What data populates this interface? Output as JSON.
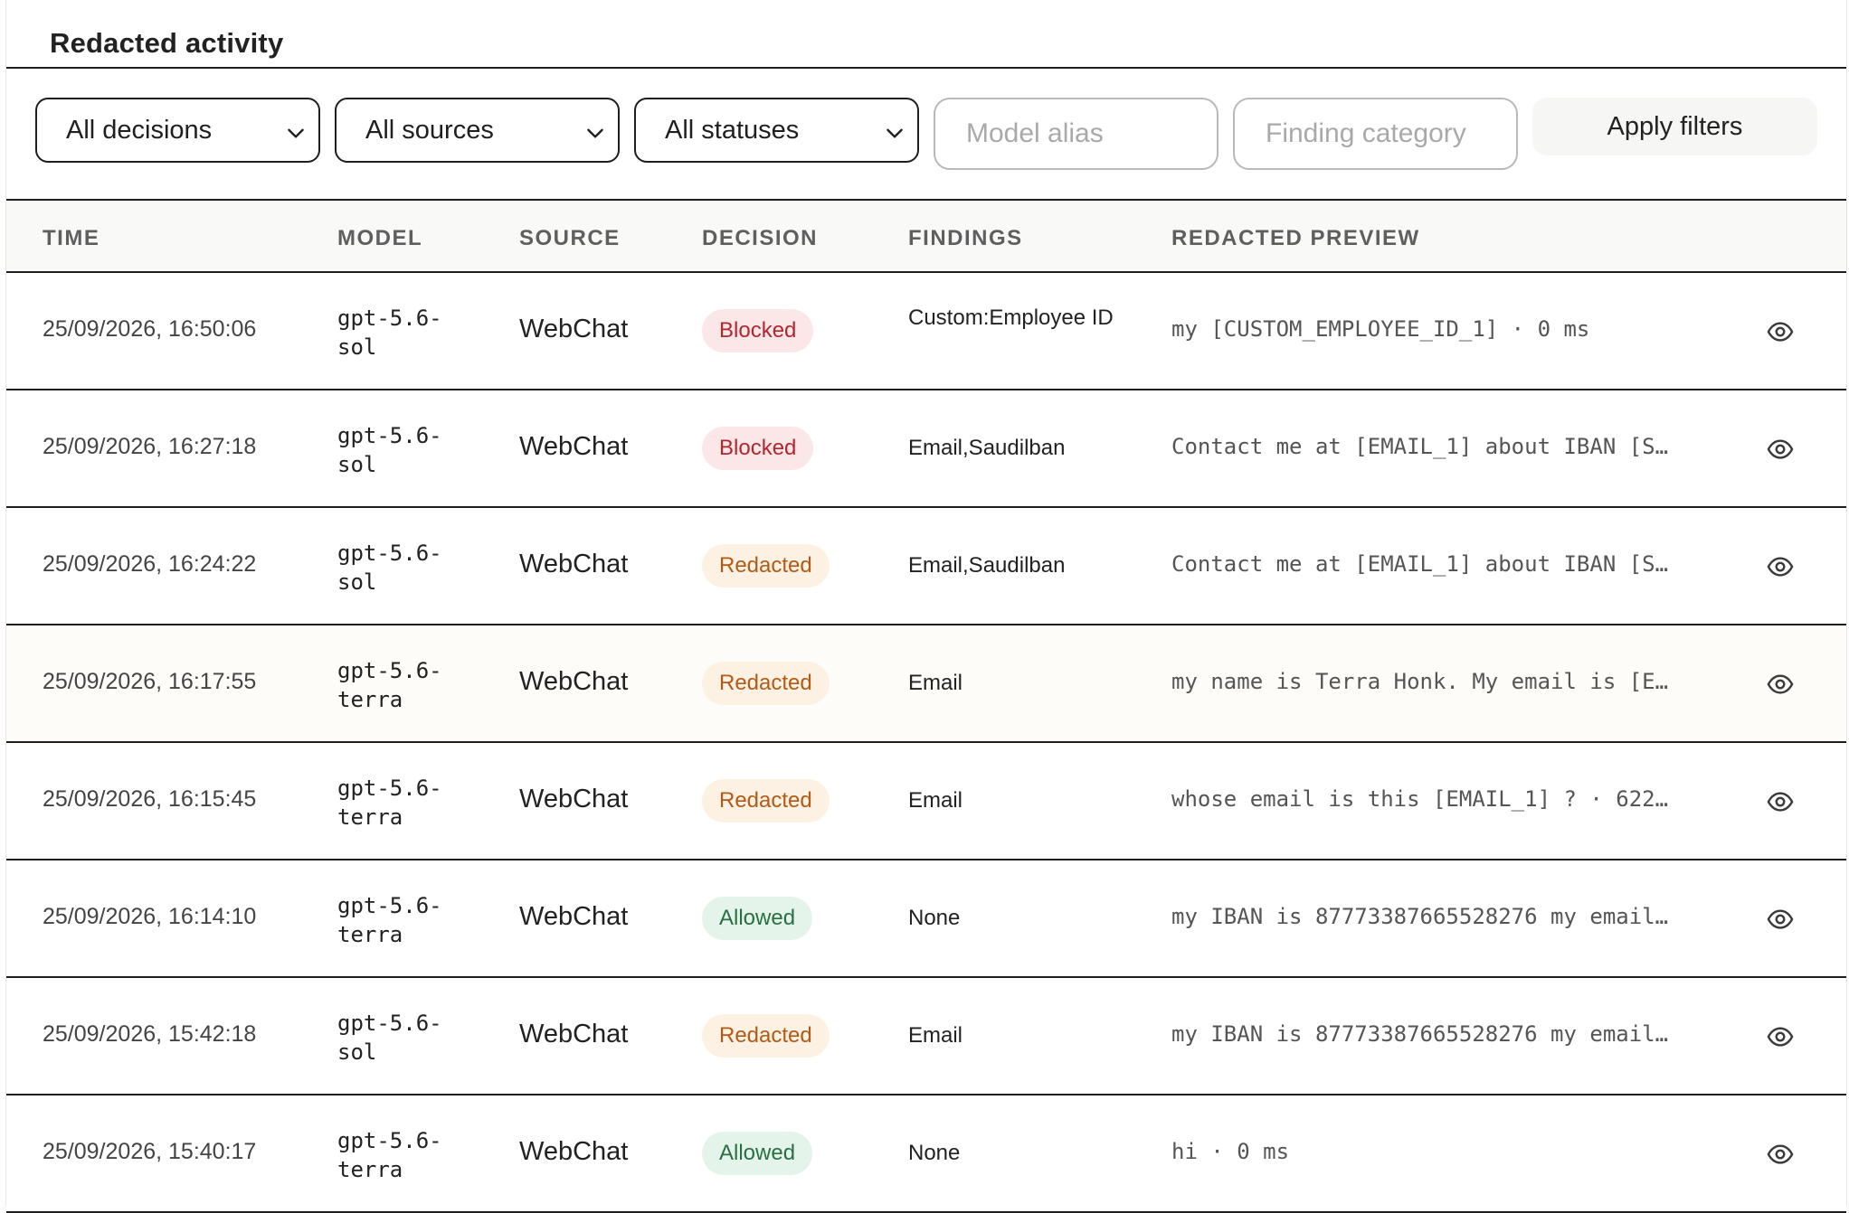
{
  "panel": {
    "title": "Redacted activity"
  },
  "filters": {
    "decision": {
      "selected": "All decisions"
    },
    "source": {
      "selected": "All sources"
    },
    "status": {
      "selected": "All statuses"
    },
    "model_alias": {
      "placeholder": "Model alias",
      "value": ""
    },
    "finding_category": {
      "placeholder": "Finding category",
      "value": ""
    },
    "apply_label": "Apply filters"
  },
  "table": {
    "headers": {
      "time": "TIME",
      "model": "MODEL",
      "source": "SOURCE",
      "decision": "DECISION",
      "findings": "FINDINGS",
      "preview": "REDACTED PREVIEW"
    },
    "rows": [
      {
        "time": "25/09/2026, 16:50:06",
        "model": "gpt-5.6-sol",
        "source": "WebChat",
        "decision": "Blocked",
        "findings": "Custom:Employee ID",
        "preview": "my [CUSTOM_EMPLOYEE_ID_1] · 0 ms"
      },
      {
        "time": "25/09/2026, 16:27:18",
        "model": "gpt-5.6-sol",
        "source": "WebChat",
        "decision": "Blocked",
        "findings": "Email,Saudilban",
        "preview": "Contact me at [EMAIL_1] about IBAN [S…"
      },
      {
        "time": "25/09/2026, 16:24:22",
        "model": "gpt-5.6-sol",
        "source": "WebChat",
        "decision": "Redacted",
        "findings": "Email,Saudilban",
        "preview": "Contact me at [EMAIL_1] about IBAN [S…"
      },
      {
        "time": "25/09/2026, 16:17:55",
        "model": "gpt-5.6-terra",
        "source": "WebChat",
        "decision": "Redacted",
        "findings": "Email",
        "preview": "my name is Terra Honk. My email is [E…"
      },
      {
        "time": "25/09/2026, 16:15:45",
        "model": "gpt-5.6-terra",
        "source": "WebChat",
        "decision": "Redacted",
        "findings": "Email",
        "preview": "whose email is this [EMAIL_1] ? · 622…"
      },
      {
        "time": "25/09/2026, 16:14:10",
        "model": "gpt-5.6-terra",
        "source": "WebChat",
        "decision": "Allowed",
        "findings": "None",
        "preview": "my IBAN is 87773387665528276 my email…"
      },
      {
        "time": "25/09/2026, 15:42:18",
        "model": "gpt-5.6-sol",
        "source": "WebChat",
        "decision": "Redacted",
        "findings": "Email",
        "preview": "my IBAN is 87773387665528276 my email…"
      },
      {
        "time": "25/09/2026, 15:40:17",
        "model": "gpt-5.6-terra",
        "source": "WebChat",
        "decision": "Allowed",
        "findings": "None",
        "preview": "hi · 0 ms"
      }
    ]
  },
  "colors": {
    "blocked_text": "#b3262d",
    "blocked_bg": "#fbe7e8",
    "redacted_text": "#b35a16",
    "redacted_bg": "#fdf1e3",
    "allowed_text": "#287043",
    "allowed_bg": "#e5f4ea"
  },
  "icons": {
    "select_caret": "chevron-down-icon",
    "row_action": "eye-icon"
  }
}
